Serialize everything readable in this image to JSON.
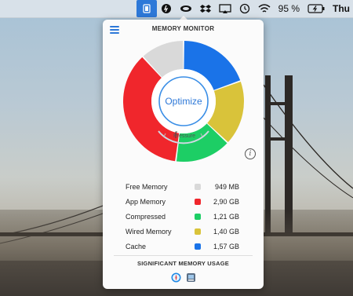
{
  "menubar": {
    "icons": [
      "memory-monitor-icon",
      "power-icon",
      "cloud-icon",
      "dropbox-icon",
      "airplay-icon",
      "time-machine-icon",
      "wifi-icon"
    ],
    "battery_percent": "95 %",
    "day": "Thu",
    "active_color": "#2d78d8"
  },
  "popover": {
    "title": "MEMORY MONITOR",
    "optimize_label": "Optimize",
    "pressure_label": "Pressure",
    "section_label": "SIGNIFICANT MEMORY USAGE"
  },
  "memory": [
    {
      "label": "Free Memory",
      "value": "949 MB",
      "gb": 0.949,
      "color": "#d9d9d9"
    },
    {
      "label": "App Memory",
      "value": "2,90 GB",
      "gb": 2.9,
      "color": "#f0262c"
    },
    {
      "label": "Compressed",
      "value": "1,21 GB",
      "gb": 1.21,
      "color": "#1dce65"
    },
    {
      "label": "Wired Memory",
      "value": "1,40 GB",
      "gb": 1.4,
      "color": "#d9c33a"
    },
    {
      "label": "Cache",
      "value": "1,57 GB",
      "gb": 1.57,
      "color": "#1a73e8"
    }
  ],
  "ring_order": [
    "Cache",
    "Wired Memory",
    "Compressed",
    "App Memory",
    "Free Memory"
  ],
  "significant_apps": [
    "safari-icon",
    "preview-icon"
  ]
}
